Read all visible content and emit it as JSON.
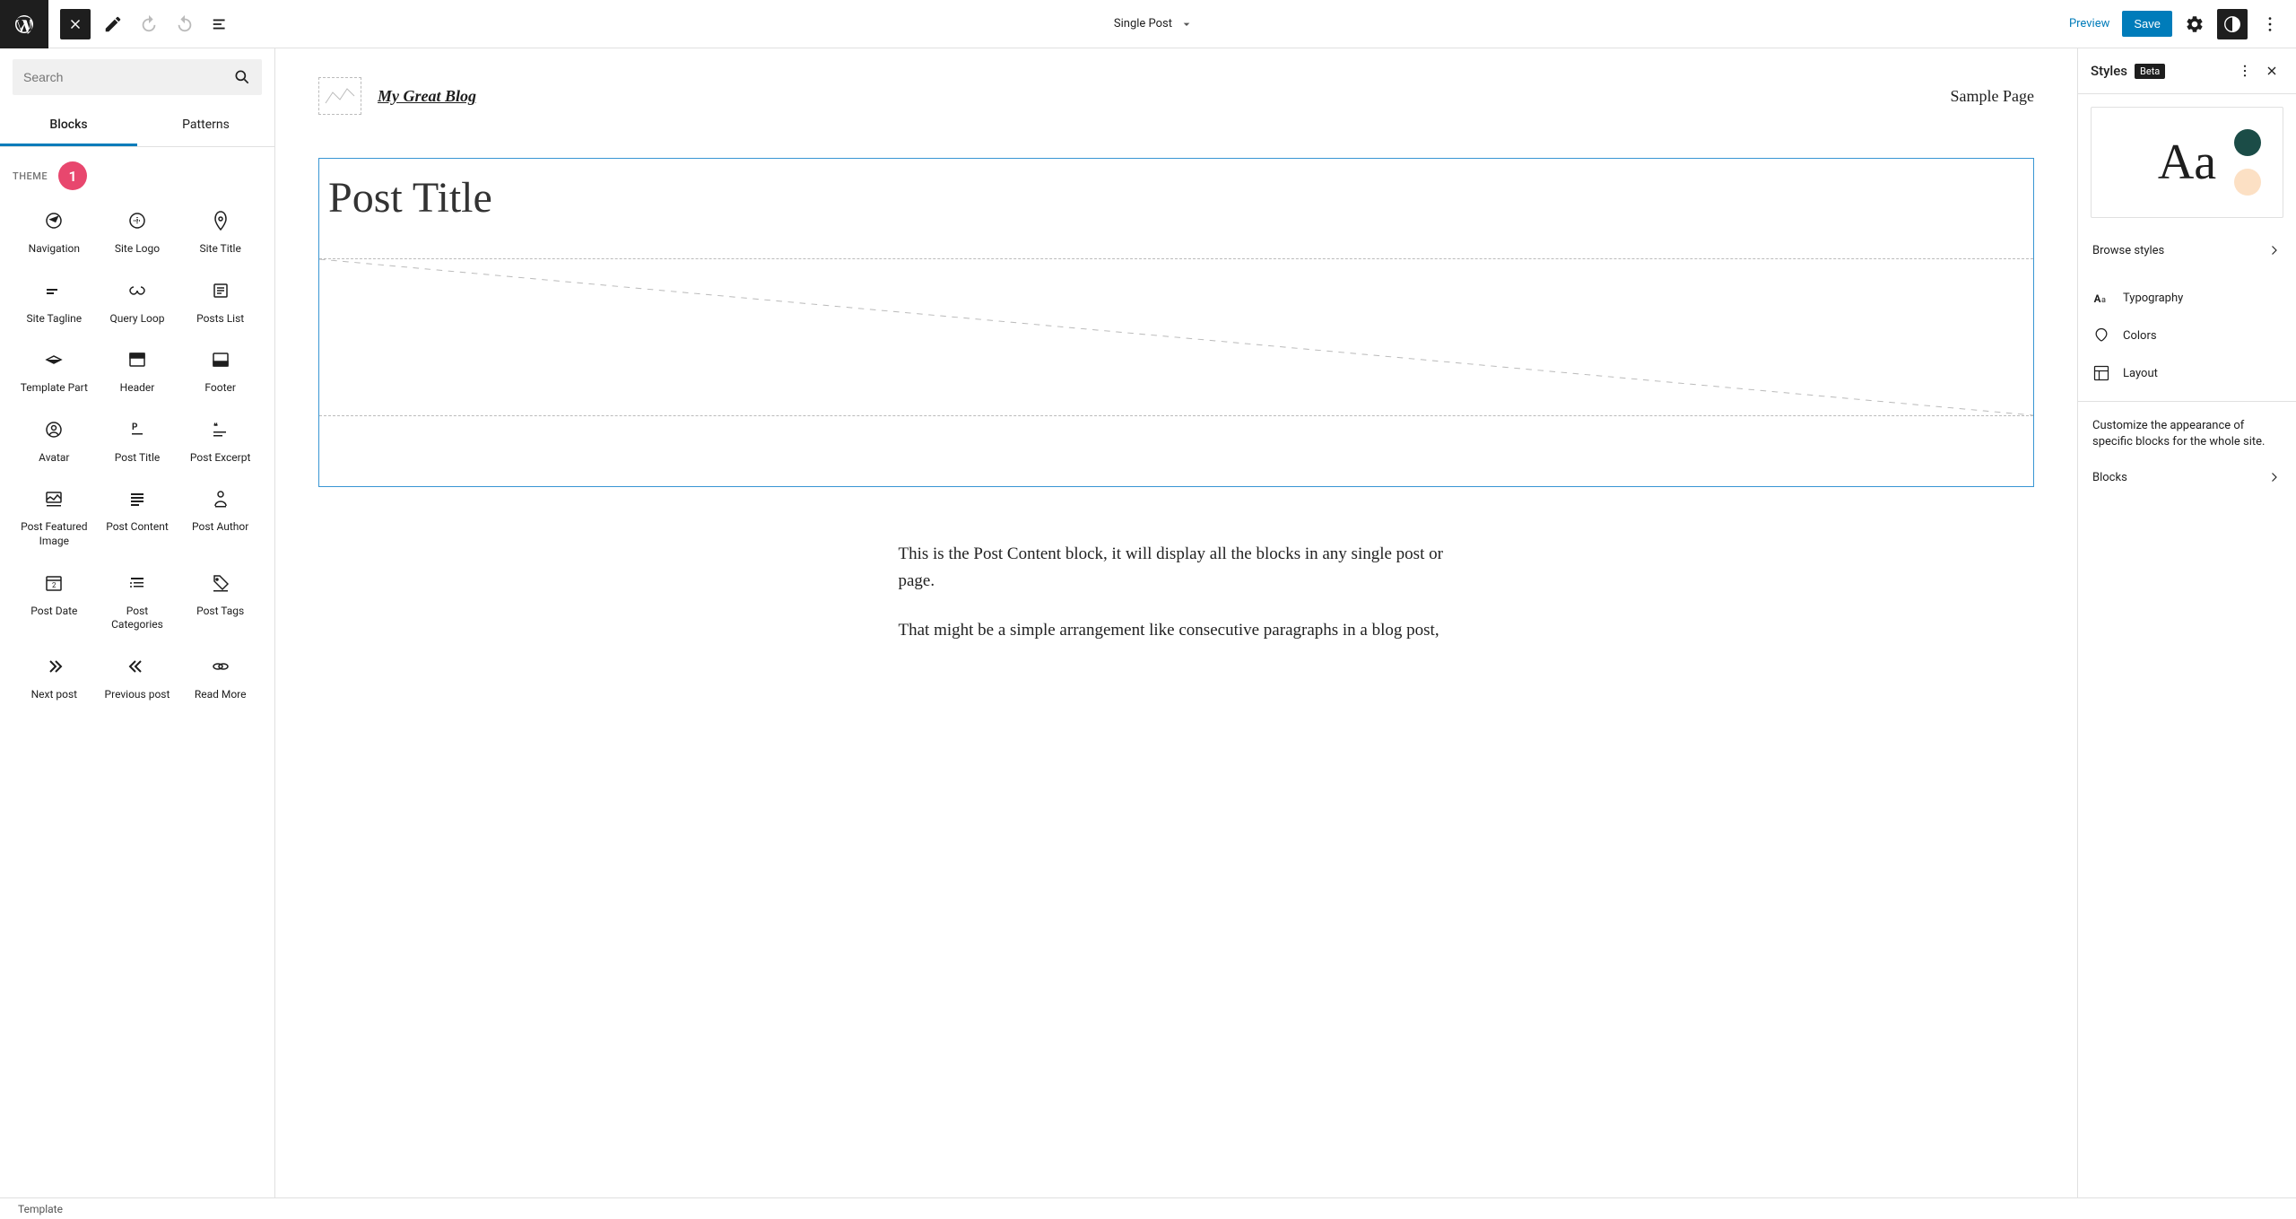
{
  "topbar": {
    "template_name": "Single Post",
    "preview": "Preview",
    "save": "Save"
  },
  "leftSidebar": {
    "search_placeholder": "Search",
    "tabs": {
      "blocks": "Blocks",
      "patterns": "Patterns"
    },
    "category": {
      "label": "THEME",
      "annotation": "1"
    },
    "blocks": [
      {
        "label": "Navigation",
        "icon": "navigation"
      },
      {
        "label": "Site Logo",
        "icon": "site-logo"
      },
      {
        "label": "Site Title",
        "icon": "site-title"
      },
      {
        "label": "Site Tagline",
        "icon": "site-tagline"
      },
      {
        "label": "Query Loop",
        "icon": "query-loop"
      },
      {
        "label": "Posts List",
        "icon": "posts-list"
      },
      {
        "label": "Template Part",
        "icon": "template-part"
      },
      {
        "label": "Header",
        "icon": "header"
      },
      {
        "label": "Footer",
        "icon": "footer"
      },
      {
        "label": "Avatar",
        "icon": "avatar"
      },
      {
        "label": "Post Title",
        "icon": "post-title"
      },
      {
        "label": "Post Excerpt",
        "icon": "post-excerpt"
      },
      {
        "label": "Post Featured Image",
        "icon": "post-featured-image"
      },
      {
        "label": "Post Content",
        "icon": "post-content"
      },
      {
        "label": "Post Author",
        "icon": "post-author"
      },
      {
        "label": "Post Date",
        "icon": "post-date"
      },
      {
        "label": "Post Categories",
        "icon": "post-categories"
      },
      {
        "label": "Post Tags",
        "icon": "post-tags"
      },
      {
        "label": "Next post",
        "icon": "next-post"
      },
      {
        "label": "Previous post",
        "icon": "previous-post"
      },
      {
        "label": "Read More",
        "icon": "read-more"
      }
    ]
  },
  "canvas": {
    "site_title": "My Great Blog",
    "nav_link": "Sample Page",
    "post_title": "Post Title",
    "p1": "This is the Post Content block, it will display all the blocks in any single post or page.",
    "p2": "That might be a simple arrangement like consecutive paragraphs in a blog post,"
  },
  "rightSidebar": {
    "title": "Styles",
    "beta": "Beta",
    "preview_text": "Aa",
    "swatch1": "#1b4c47",
    "swatch2": "#fce0c4",
    "browse": "Browse styles",
    "typography": "Typography",
    "colors": "Colors",
    "layout": "Layout",
    "help": "Customize the appearance of specific blocks for the whole site.",
    "blocks": "Blocks"
  },
  "statusBar": {
    "text": "Template"
  }
}
